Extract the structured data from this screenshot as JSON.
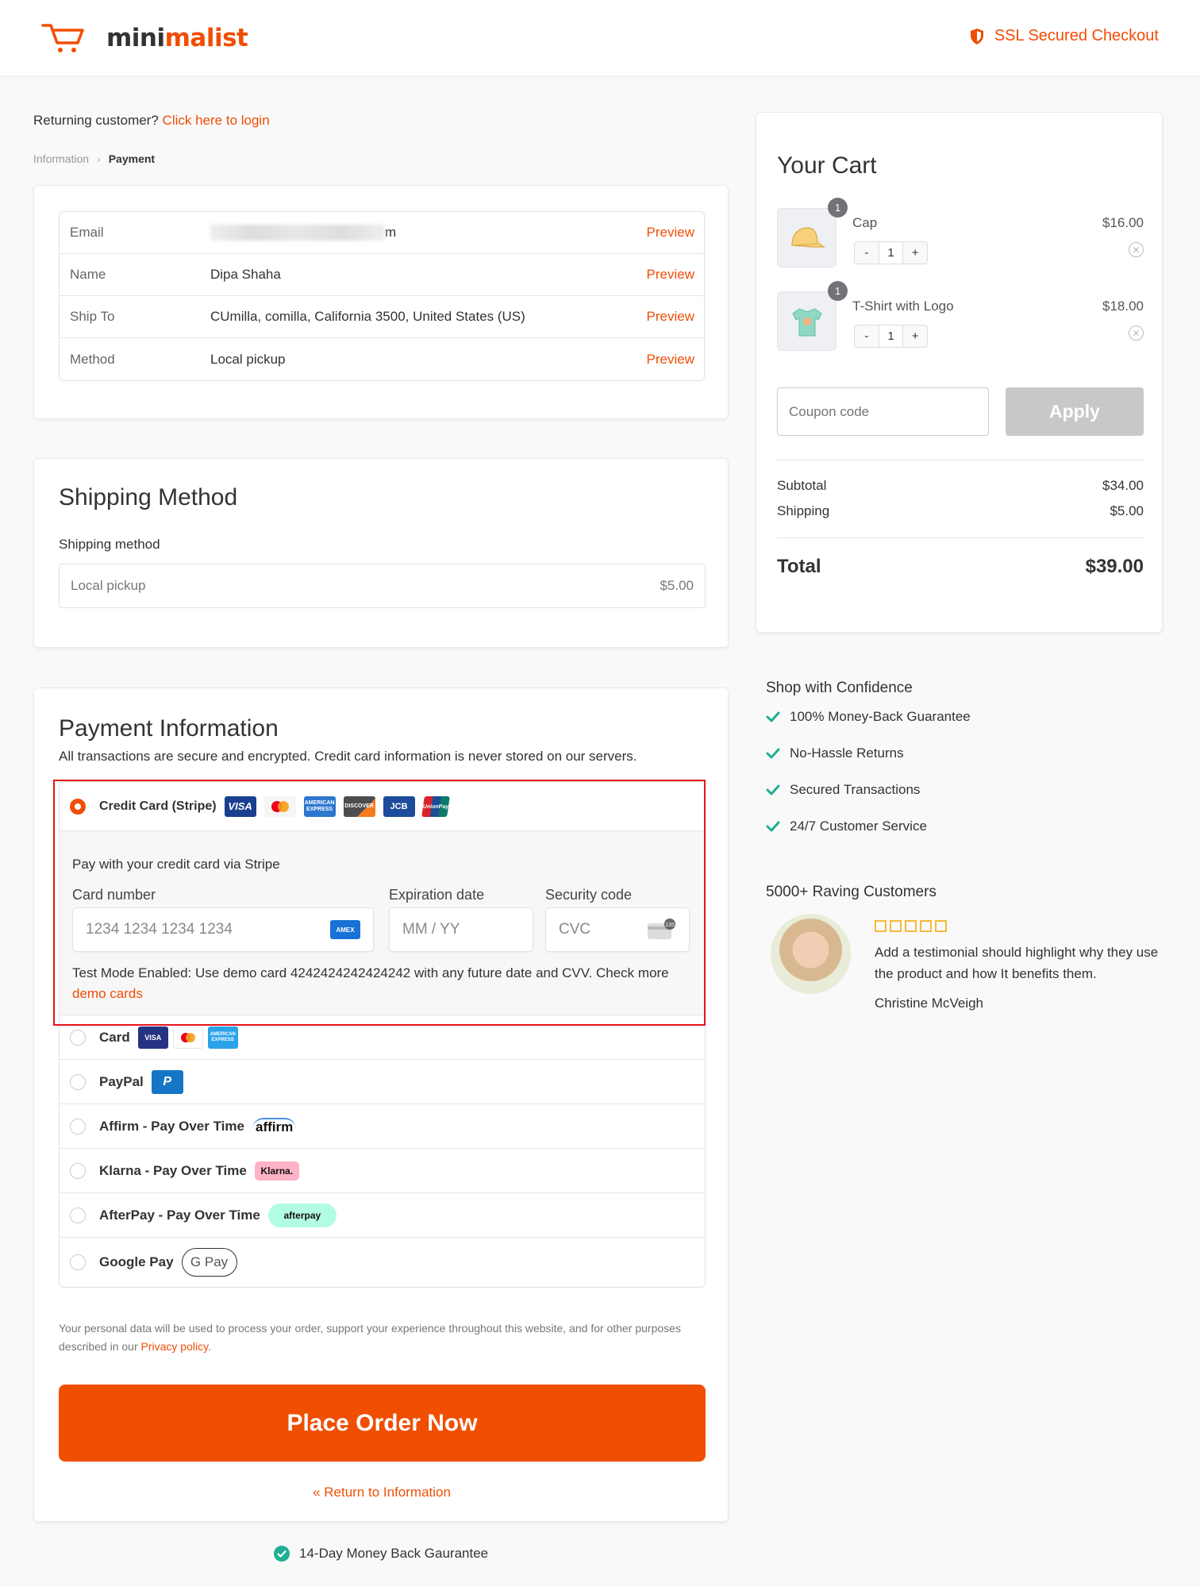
{
  "header": {
    "brand_part1": "mini",
    "brand_part2": "malist",
    "ssl_label": "SSL Secured Checkout",
    "accent_color": "#f04e06"
  },
  "login_prompt": {
    "text": "Returning customer?",
    "link": "Click here to login"
  },
  "breadcrumb": [
    {
      "label": "Information",
      "active": false
    },
    {
      "label": "Payment",
      "active": true
    }
  ],
  "info_table": {
    "rows": [
      {
        "label": "Email",
        "value": "m",
        "redacted": true,
        "action": "Preview"
      },
      {
        "label": "Name",
        "value": "Dipa Shaha",
        "action": "Preview"
      },
      {
        "label": "Ship To",
        "value": "CUmilla, comilla, California 3500, United States (US)",
        "action": "Preview"
      },
      {
        "label": "Method",
        "value": "Local pickup",
        "action": "Preview"
      }
    ]
  },
  "shipping": {
    "title": "Shipping Method",
    "label": "Shipping method",
    "option": "Local pickup",
    "price": "$5.00"
  },
  "payment": {
    "title": "Payment Information",
    "subtitle": "All transactions are secure and encrypted. Credit card information is never stored on our servers.",
    "stripe": {
      "label": "Credit Card (Stripe)",
      "selected": true,
      "card_icons": [
        "visa-icon",
        "mastercard-icon",
        "amex-icon",
        "discover-icon",
        "jcb-icon",
        "unionpay-icon"
      ],
      "intro": "Pay with your credit card via Stripe",
      "card_number_label": "Card number",
      "card_number_placeholder": "1234 1234 1234 1234",
      "expiry_label": "Expiration date",
      "expiry_placeholder": "MM / YY",
      "cvc_label": "Security code",
      "cvc_placeholder": "CVC",
      "test_mode_text": "Test Mode Enabled: Use demo card 4242424242424242 with any future date and CVV. Check more",
      "demo_cards_link": "demo cards"
    },
    "methods": [
      {
        "label": "Card",
        "badges": [
          "VISA",
          "MC",
          "AMEX"
        ]
      },
      {
        "label": "PayPal",
        "badges": [
          "P"
        ]
      },
      {
        "label": "Affirm - Pay Over Time",
        "badges": [
          "affirm"
        ]
      },
      {
        "label": "Klarna - Pay Over Time",
        "badges": [
          "Klarna."
        ]
      },
      {
        "label": "AfterPay - Pay Over Time",
        "badges": [
          "afterpay"
        ]
      },
      {
        "label": "Google Pay",
        "badges": [
          "G Pay"
        ]
      }
    ],
    "privacy_text": "Your personal data will be used to process your order, support your experience throughout this website, and for other purposes described in our",
    "privacy_link": "Privacy policy",
    "place_order": "Place Order Now",
    "return_link": "« Return to Information"
  },
  "guarantee": "14-Day Money Back Gaurantee",
  "cart": {
    "title": "Your Cart",
    "items": [
      {
        "name": "Cap",
        "price": "$16.00",
        "qty": "1",
        "badge": "1"
      },
      {
        "name": "T-Shirt with Logo",
        "price": "$18.00",
        "qty": "1",
        "badge": "1"
      }
    ],
    "coupon_placeholder": "Coupon code",
    "apply": "Apply",
    "subtotal_label": "Subtotal",
    "subtotal": "$34.00",
    "shipping_label": "Shipping",
    "shipping": "$5.00",
    "total_label": "Total",
    "total": "$39.00"
  },
  "confidence": {
    "title": "Shop with Confidence",
    "items": [
      "100% Money-Back Guarantee",
      "No-Hassle Returns",
      "Secured Transactions",
      "24/7 Customer Service"
    ],
    "check_color": "#1fae93"
  },
  "testimonial": {
    "title": "5000+ Raving Customers",
    "rating": 5,
    "text": "Add a testimonial should highlight why they use the product and how It benefits them.",
    "author": "Christine McVeigh"
  }
}
